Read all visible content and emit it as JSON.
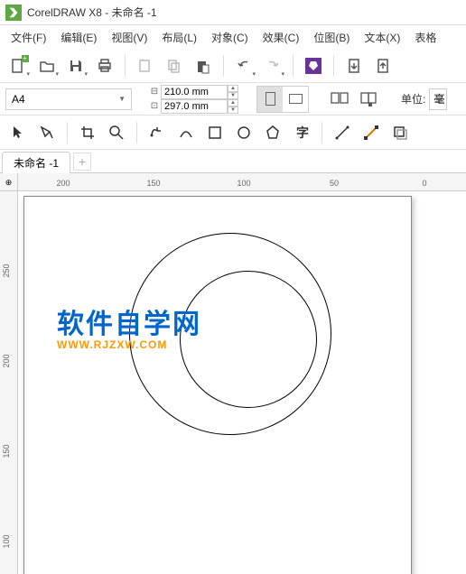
{
  "window": {
    "title": "CorelDRAW X8 - 未命名 -1"
  },
  "menu": {
    "file": "文件(F)",
    "edit": "编辑(E)",
    "view": "视图(V)",
    "layout": "布局(L)",
    "object": "对象(C)",
    "effects": "效果(C)",
    "bitmaps": "位图(B)",
    "text": "文本(X)",
    "table": "表格"
  },
  "property_bar": {
    "page_size": "A4",
    "width": "210.0 mm",
    "height": "297.0 mm",
    "unit_label": "单位:",
    "unit_value": "毫"
  },
  "tabs": {
    "doc1": "未命名 -1"
  },
  "ruler": {
    "h": [
      "200",
      "150",
      "100",
      "50",
      "0"
    ],
    "v": [
      "250",
      "200",
      "150",
      "100"
    ]
  },
  "watermark": {
    "cn": "软件自学网",
    "en": "WWW.RJZXW.COM"
  },
  "chart_data": {
    "type": "other",
    "note": "Vector drawing: two concentric black-outline circles on an A4 page",
    "shapes": [
      {
        "kind": "circle",
        "stroke": "#000000",
        "fill": "none",
        "approx_diameter_mm": 110
      },
      {
        "kind": "circle",
        "stroke": "#000000",
        "fill": "none",
        "approx_diameter_mm": 75
      }
    ]
  }
}
